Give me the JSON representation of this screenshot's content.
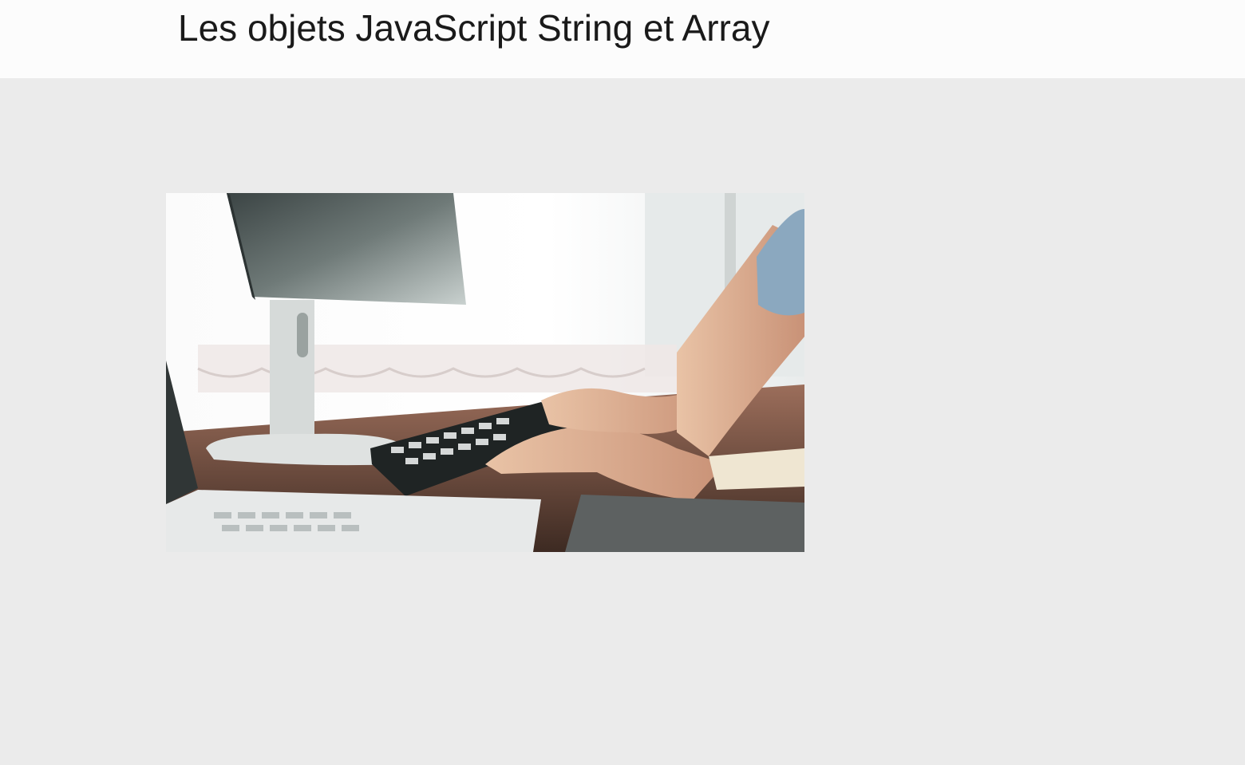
{
  "header": {
    "title": "Les objets JavaScript String et Array"
  },
  "main": {
    "hero_image": {
      "icon": "photo-of-hands-typing-on-keyboard"
    }
  },
  "colors": {
    "header_bg": "#fcfcfc",
    "page_bg": "#ebebeb",
    "title_text": "#1a1a1a"
  }
}
